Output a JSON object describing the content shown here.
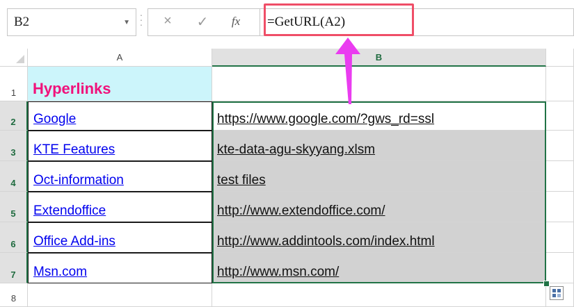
{
  "formula_bar": {
    "name_box": "B2",
    "cancel_icon": "×",
    "enter_icon": "✓",
    "fx_label": "fx",
    "formula": "=GetURL(A2)"
  },
  "columns": [
    "A",
    "B"
  ],
  "rows": [
    {
      "num": "1",
      "a": "Hyperlinks",
      "b": ""
    },
    {
      "num": "2",
      "a": "Google",
      "b": "https://www.google.com/?gws_rd=ssl"
    },
    {
      "num": "3",
      "a": "KTE Features",
      "b": "kte-data-agu-skyyang.xlsm"
    },
    {
      "num": "4",
      "a": "Oct-information",
      "b": "test files"
    },
    {
      "num": "5",
      "a": "Extendoffice",
      "b": "http://www.extendoffice.com/"
    },
    {
      "num": "6",
      "a": "Office Add-ins",
      "b": "http://www.addintools.com/index.html"
    },
    {
      "num": "7",
      "a": "Msn.com",
      "b": "http://www.msn.com/"
    },
    {
      "num": "8",
      "a": "",
      "b": ""
    }
  ],
  "colors": {
    "accent": "#217346",
    "highlight_box": "#ef4e67",
    "arrow": "#ea3cf0",
    "header_text": "#f0127b",
    "header_fill": "#ccf5fb",
    "link": "#0000ee"
  }
}
